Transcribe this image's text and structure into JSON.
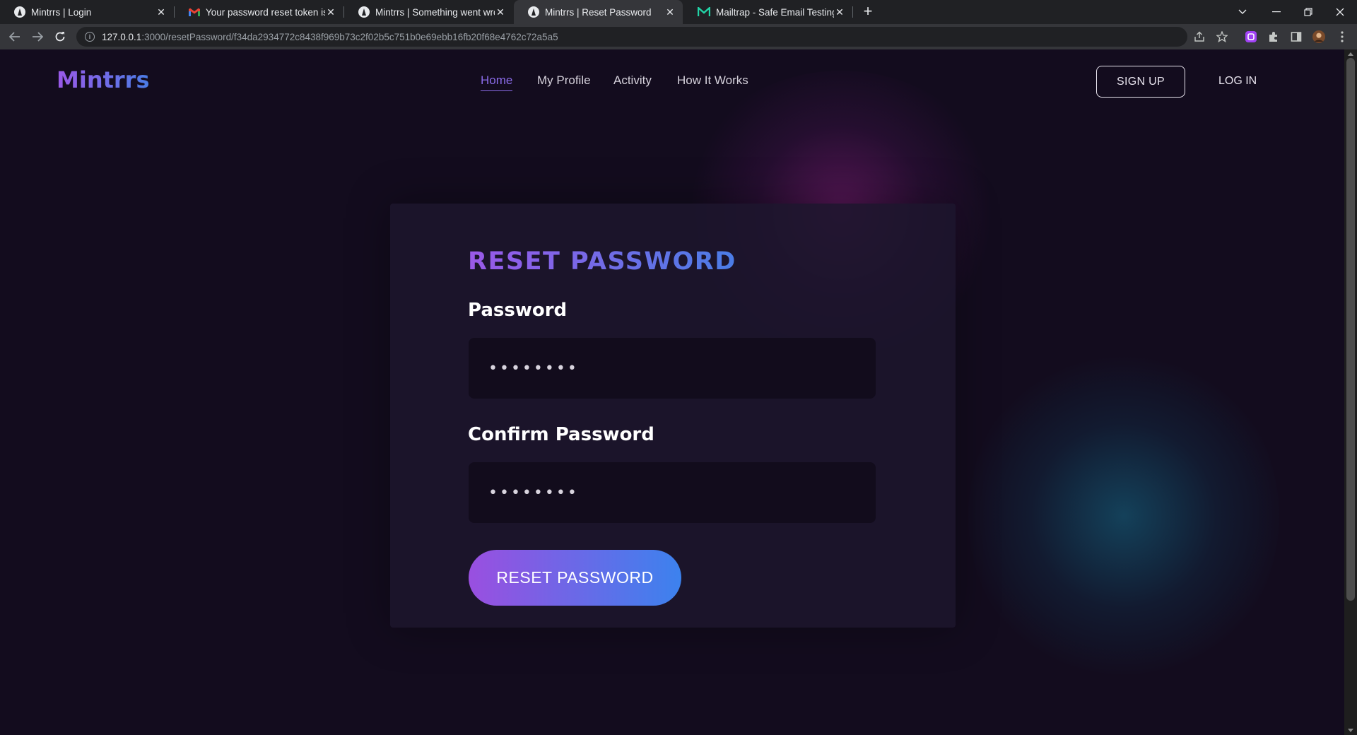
{
  "browser": {
    "tabs": [
      {
        "title": "Mintrrs | Login",
        "favicon": "mintrrs-logo-icon",
        "active": false
      },
      {
        "title": "Your password reset token is vali",
        "favicon": "gmail-icon",
        "active": false
      },
      {
        "title": "Mintrrs | Something went wrong",
        "favicon": "mintrrs-logo-icon",
        "active": false
      },
      {
        "title": "Mintrrs | Reset Password",
        "favicon": "mintrrs-logo-icon",
        "active": true
      },
      {
        "title": "Mailtrap - Safe Email Testing",
        "favicon": "mailtrap-icon",
        "active": false
      }
    ],
    "url_host": "127.0.0.1",
    "url_path": ":3000/resetPassword/f34da2934772c8438f969b73c2f02b5c751b0e69ebb16fb20f68e4762c72a5a5"
  },
  "site": {
    "brand": "Mintrrs",
    "nav": [
      {
        "label": "Home",
        "active": true
      },
      {
        "label": "My Profile",
        "active": false
      },
      {
        "label": "Activity",
        "active": false
      },
      {
        "label": "How It Works",
        "active": false
      }
    ],
    "signup_label": "SIGN UP",
    "login_label": "LOG IN"
  },
  "form": {
    "title": "RESET PASSWORD",
    "password_label": "Password",
    "password_value": "••••••••",
    "confirm_label": "Confirm Password",
    "confirm_value": "••••••••",
    "submit_label": "RESET PASSWORD"
  },
  "colors": {
    "page_bg": "#130c1e",
    "card_bg": "#1c162c",
    "accent_start": "#9a4fe0",
    "accent_end": "#3c82ee",
    "nav_active": "#8a6be8"
  }
}
